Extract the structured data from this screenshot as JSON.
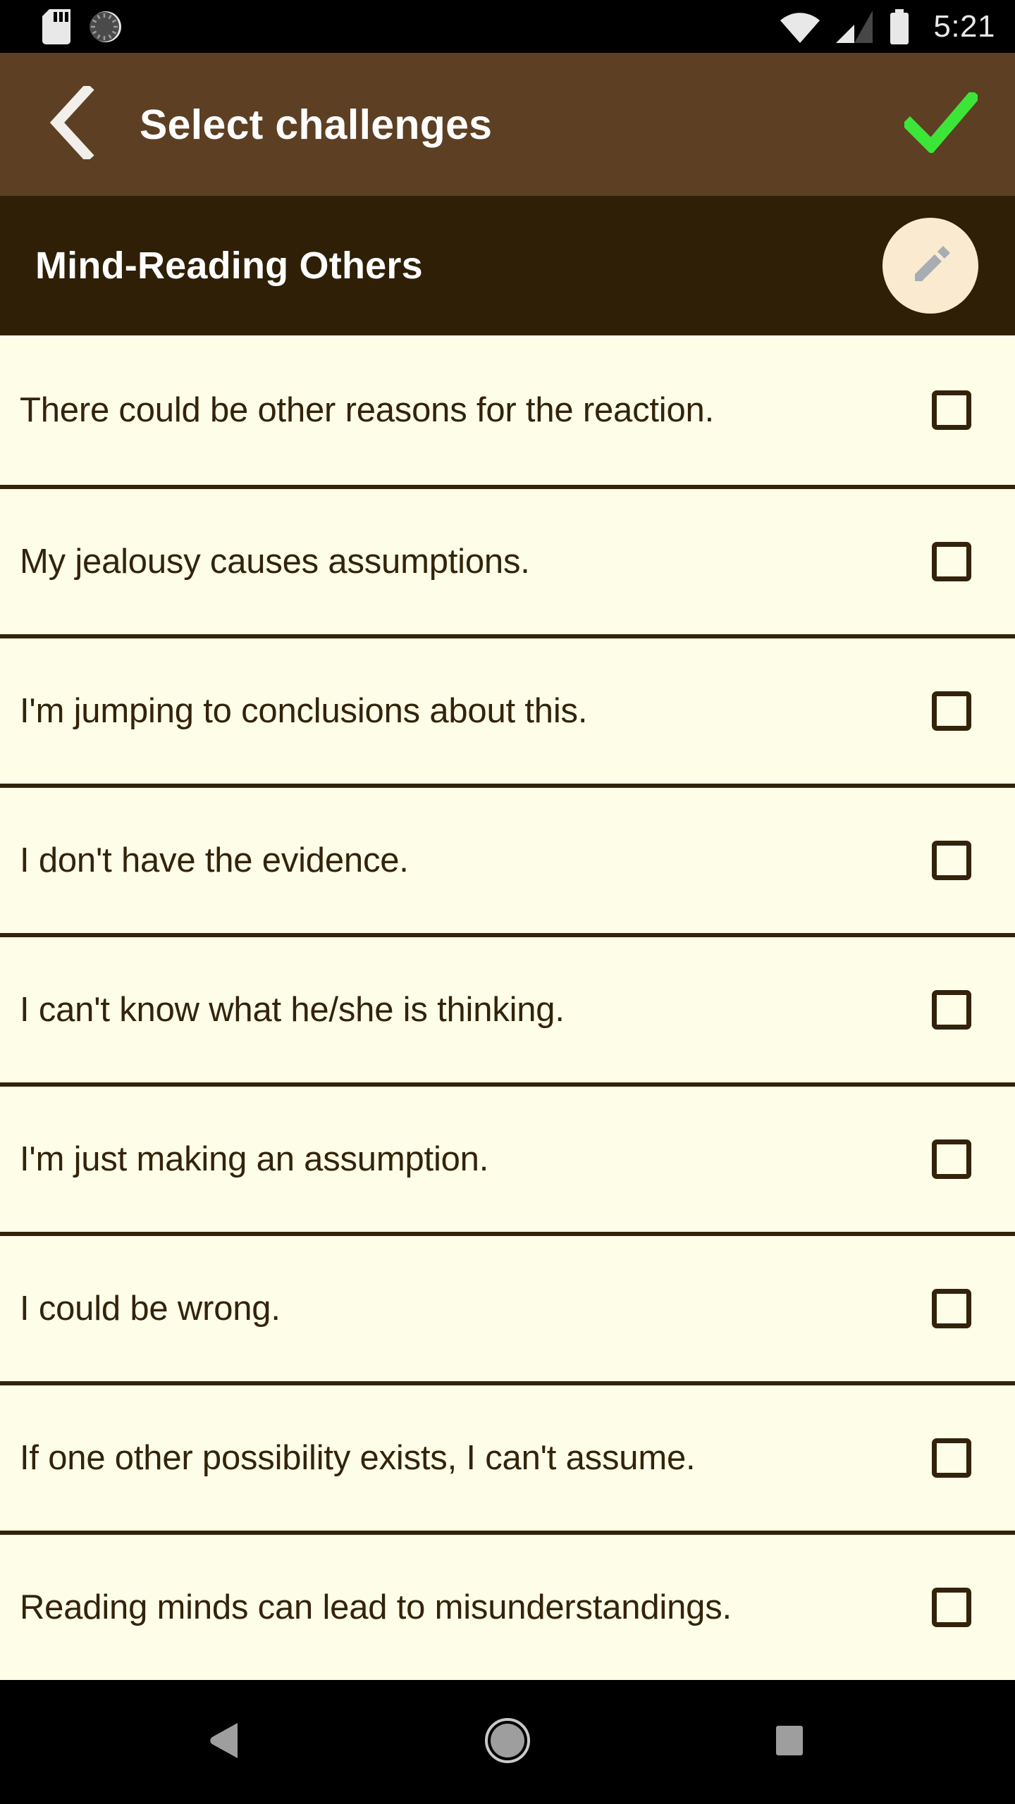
{
  "status_bar": {
    "time": "5:21",
    "icons": [
      "sd-card-icon",
      "spinner-icon",
      "wifi-icon",
      "cellular-signal-icon",
      "battery-icon"
    ]
  },
  "app_bar": {
    "back_icon": "chevron-left-icon",
    "title": "Select challenges",
    "confirm_icon": "check-icon",
    "background_color": "#5D3F23",
    "confirm_color": "#3CE639"
  },
  "sub_bar": {
    "title": "Mind-Reading Others",
    "edit_icon": "pencil-icon",
    "background_color": "#2E1F06",
    "fab_color": "#FAEBD0"
  },
  "list": {
    "background_color": "#FDFDE8",
    "text_color": "#33230A",
    "items": [
      {
        "label": "There could be other reasons for the reaction.",
        "checked": false
      },
      {
        "label": "My jealousy causes assumptions.",
        "checked": false
      },
      {
        "label": "I'm jumping to conclusions about this.",
        "checked": false
      },
      {
        "label": "I don't have the evidence.",
        "checked": false
      },
      {
        "label": "I can't know what he/she is thinking.",
        "checked": false
      },
      {
        "label": "I'm just making an assumption.",
        "checked": false
      },
      {
        "label": "I could be wrong.",
        "checked": false
      },
      {
        "label": "If one other possibility exists, I can't assume.",
        "checked": false
      },
      {
        "label": "Reading minds can lead to misunderstandings.",
        "checked": false
      }
    ]
  },
  "nav_bar": {
    "back_icon": "triangle-back-icon",
    "home_icon": "circle-home-icon",
    "recents_icon": "square-recents-icon"
  }
}
